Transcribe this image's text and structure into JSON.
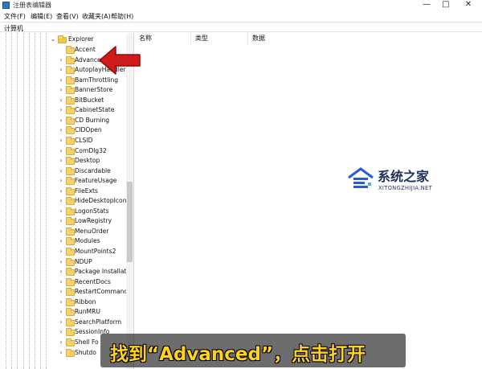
{
  "window": {
    "title": "注册表编辑器",
    "minimize_glyph": "—",
    "maximize_glyph": "□",
    "close_glyph": "✕"
  },
  "menu": [
    "文件(F)",
    "编辑(E)",
    "查看(V)",
    "收藏夹(A)",
    "帮助(H)"
  ],
  "address": "计算机",
  "tree": {
    "parent": "Explorer",
    "children": [
      "Accent",
      "Advanced",
      "AutoplayHandlers",
      "BamThrottling",
      "BannerStore",
      "BitBucket",
      "CabinetState",
      "CD Burning",
      "CIDOpen",
      "CLSID",
      "ComDlg32",
      "Desktop",
      "Discardable",
      "FeatureUsage",
      "FileExts",
      "HideDesktopIcons",
      "LogonStats",
      "LowRegistry",
      "MenuOrder",
      "Modules",
      "MountPoints2",
      "NDUP",
      "Package Installatio",
      "RecentDocs",
      "RestartCommands",
      "Ribbon",
      "RunMRU",
      "SearchPlatform",
      "SessionInfo",
      "Shell Fo",
      "Shutdo"
    ],
    "selected": "Advanced"
  },
  "columns": [
    "名称",
    "类型",
    "数据"
  ],
  "watermark": {
    "title": "系统之家",
    "subtitle": "XITONGZHIJIA.NET"
  },
  "annotation": {
    "caption": "找到“Advanced”，点击打开",
    "arrow_color": "#d11a1a",
    "caption_color": "#ffd21f"
  },
  "icons": {
    "app": "registry-editor-icon",
    "folder": "folder-icon",
    "expander": "chevron-right-icon"
  }
}
